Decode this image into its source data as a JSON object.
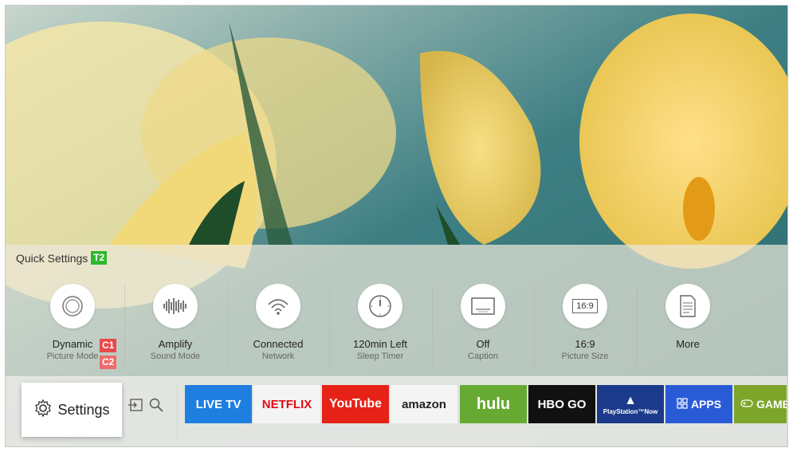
{
  "quick_settings": {
    "title": "Quick Settings",
    "tag": "T2",
    "items": [
      {
        "value": "Dynamic",
        "label": "Picture Mode",
        "icon": "picture-mode-icon"
      },
      {
        "value": "Amplify",
        "label": "Sound Mode",
        "icon": "sound-wave-icon"
      },
      {
        "value": "Connected",
        "label": "Network",
        "icon": "wifi-icon"
      },
      {
        "value": "120min Left",
        "label": "Sleep Timer",
        "icon": "timer-icon"
      },
      {
        "value": "Off",
        "label": "Caption",
        "icon": "caption-icon"
      },
      {
        "value": "16:9",
        "label": "Picture Size",
        "icon": "aspect-ratio-icon"
      },
      {
        "value": "More",
        "label": "",
        "icon": "document-icon"
      }
    ],
    "tags_item1": {
      "value_tag": "C1",
      "label_tag": "C2"
    },
    "aspect_icon_text": "16:9"
  },
  "bottom_bar": {
    "settings_label": "Settings",
    "apps": [
      {
        "label": "LIVE TV",
        "color": "#1e7fe0"
      },
      {
        "label": "NETFLIX",
        "color": "#f4f4f4",
        "text_color": "#e50914"
      },
      {
        "label": "YouTube",
        "color": "#e62117"
      },
      {
        "label": "amazon",
        "color": "#f4f4f4",
        "text_color": "#222"
      },
      {
        "label": "hulu",
        "color": "#66aa33"
      },
      {
        "label": "HBO GO",
        "color": "#111111"
      },
      {
        "label": "PlayStation™Now",
        "color": "#1b3a8c"
      },
      {
        "label": "APPS",
        "color": "#2a5bd7"
      },
      {
        "label": "GAME",
        "color": "#7da52a"
      }
    ]
  },
  "colors": {
    "tag_green": "#2db82d",
    "tag_red": "#e84a4a"
  }
}
